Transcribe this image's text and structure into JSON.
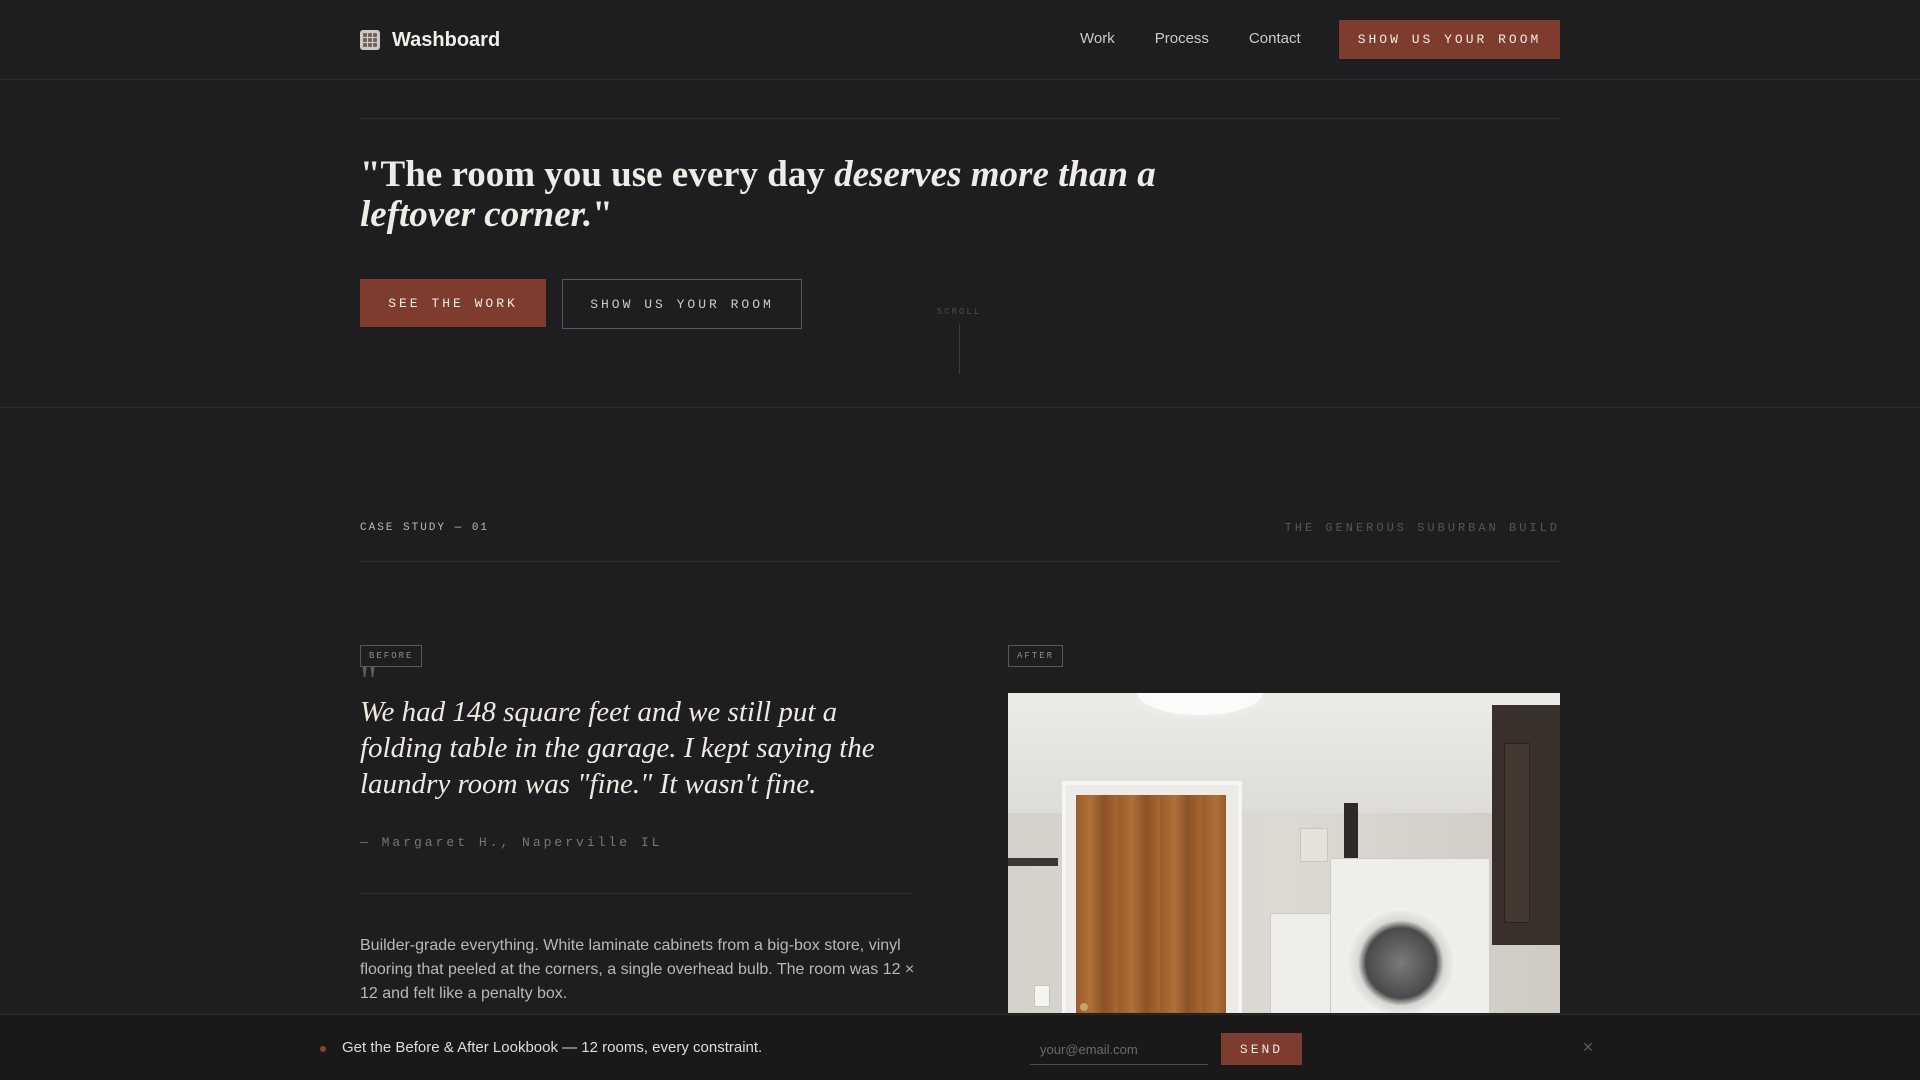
{
  "nav": {
    "brand": "Washboard",
    "links": [
      "Work",
      "Process",
      "Contact"
    ],
    "cta": "SHOW US YOUR ROOM"
  },
  "hero": {
    "quote_plain": "\"The room you use every day ",
    "quote_em": "deserves more than a leftover corner.",
    "quote_end": "\"",
    "primary_button": "SEE THE WORK",
    "secondary_button": "SHOW US YOUR ROOM",
    "scroll_label": "SCROLL"
  },
  "case_study": {
    "label": "CASE STUDY — 01",
    "title": "THE GENEROUS SUBURBAN BUILD",
    "before_tag": "BEFORE",
    "after_tag": "AFTER",
    "quote_mark": "\"",
    "testimonial": "We had 148 square feet and we still put a folding table in the garage. I kept saying the laundry room was \"fine.\" It wasn't fine.",
    "attribution": "— Margaret H., Naperville IL",
    "body": "Builder-grade everything. White laminate cabinets from a big-box store, vinyl flooring that peeled at the corners, a single overhead bulb. The room was 12 × 12 and felt like a penalty box."
  },
  "lookbook": {
    "text": "Get the Before & After Lookbook — 12 rooms, every constraint.",
    "input_placeholder": "your@email.com",
    "send": "SEND",
    "close_icon": "close-icon"
  },
  "colors": {
    "background": "#1e1e20",
    "accent": "#7d3c2d"
  }
}
